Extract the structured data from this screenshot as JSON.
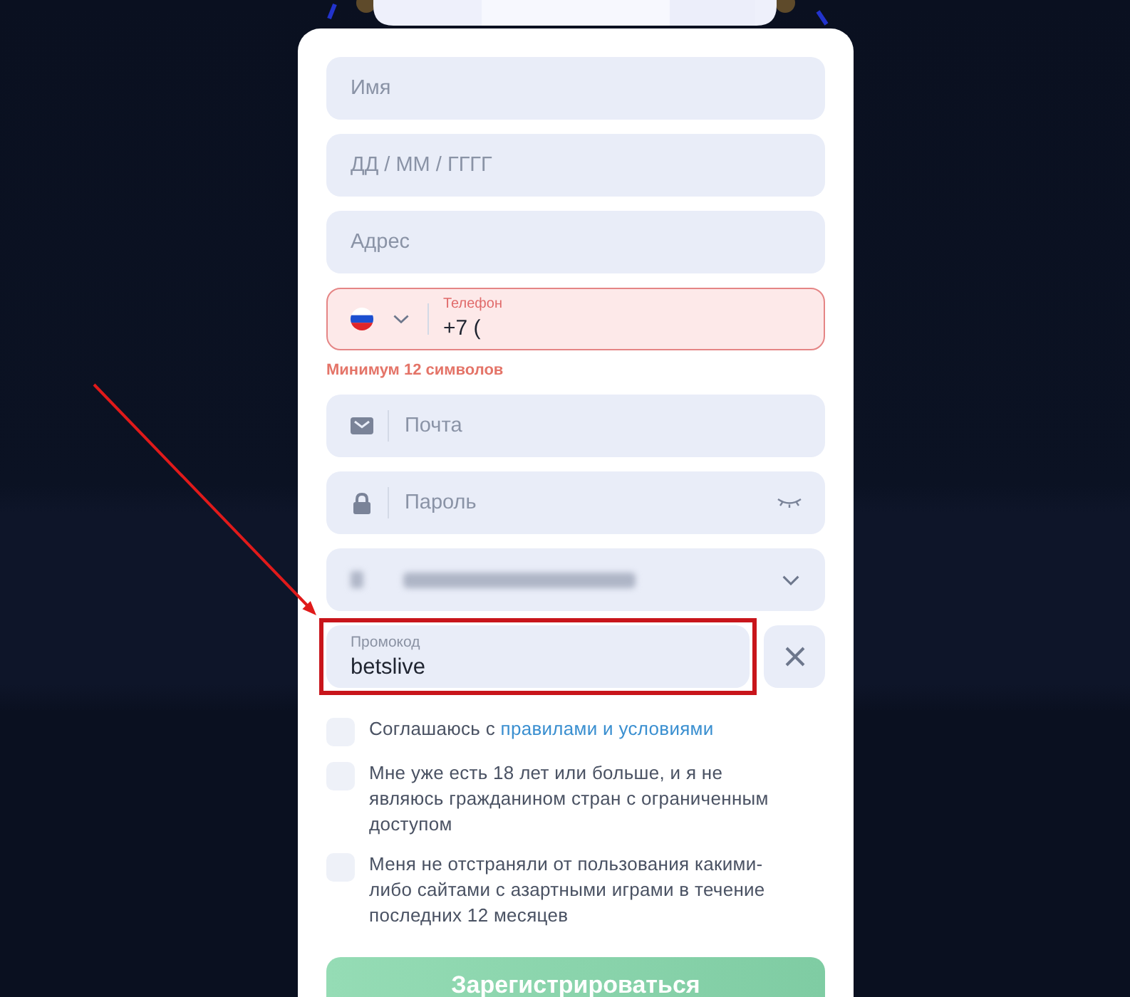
{
  "form": {
    "fields": [
      {
        "kind": "text",
        "placeholder": "Имя"
      },
      {
        "kind": "date",
        "placeholder": "ДД / ММ / ГГГГ"
      },
      {
        "kind": "text",
        "placeholder": "Адрес"
      },
      {
        "kind": "phone",
        "label": "Телефон",
        "value": "+7 (",
        "error": true,
        "error_message": "Минимум 12 символов"
      },
      {
        "kind": "email",
        "placeholder": "Почта"
      },
      {
        "kind": "password",
        "placeholder": "Пароль"
      },
      {
        "kind": "select"
      },
      {
        "kind": "promo",
        "label": "Промокод",
        "value": "betslive",
        "highlighted": true
      }
    ],
    "checkboxes": [
      {
        "text": "Соглашаюсь с",
        "link": "правилами и условиями",
        "checked": false
      },
      {
        "text": "Мне уже есть 18 лет или больше, и я не являюсь гражданином стран с ограниченным доступом",
        "checked": false
      },
      {
        "text": "Меня не отстраняли от пользования какими-либо сайтами с азартными играми в течение последних 12 месяцев",
        "checked": false
      }
    ],
    "submit": {
      "label": "Зарегистрироваться",
      "disabled": true
    }
  }
}
